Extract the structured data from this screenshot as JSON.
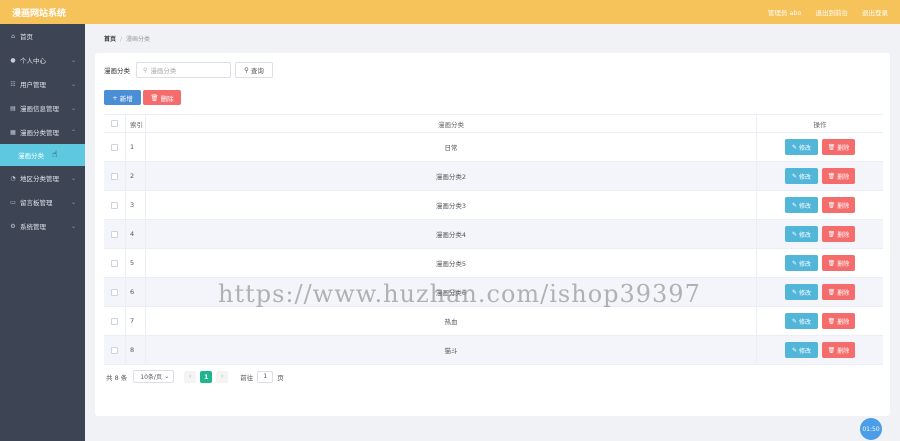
{
  "header": {
    "brand": "漫画网站系统",
    "links": [
      "管理员 abo",
      "退出到前台",
      "退出登录"
    ]
  },
  "sidebar": {
    "items": [
      {
        "icon": "home-icon",
        "glyph": "⌂",
        "label": "首页",
        "chevron": false
      },
      {
        "icon": "user-icon",
        "glyph": "●",
        "label": "个人中心",
        "chevron": true
      },
      {
        "icon": "users-icon",
        "glyph": "☷",
        "label": "用户管理",
        "chevron": true
      },
      {
        "icon": "book-icon",
        "glyph": "▤",
        "label": "漫画信息管理",
        "chevron": true
      },
      {
        "icon": "grid-icon",
        "glyph": "▦",
        "label": "漫画分类管理",
        "chevron": true
      },
      {
        "icon": "clock-icon",
        "glyph": "◔",
        "label": "地区分类管理",
        "chevron": true
      },
      {
        "icon": "message-icon",
        "glyph": "▭",
        "label": "留言板管理",
        "chevron": true
      },
      {
        "icon": "settings-icon",
        "glyph": "⚙",
        "label": "系统管理",
        "chevron": true
      }
    ],
    "active_sub": "漫画分类"
  },
  "breadcrumb": {
    "home": "首页",
    "current": "漫画分类"
  },
  "search": {
    "label": "漫画分类",
    "placeholder": "漫画分类",
    "button": "查询"
  },
  "actions": {
    "add": "新增",
    "delete": "删除"
  },
  "table": {
    "headers": {
      "index": "索引",
      "name": "漫画分类",
      "ops": "操作"
    },
    "rows": [
      {
        "index": "1",
        "name": "日常"
      },
      {
        "index": "2",
        "name": "漫画分类2"
      },
      {
        "index": "3",
        "name": "漫画分类3"
      },
      {
        "index": "4",
        "name": "漫画分类4"
      },
      {
        "index": "5",
        "name": "漫画分类5"
      },
      {
        "index": "6",
        "name": "漫画分类6"
      },
      {
        "index": "7",
        "name": "热血"
      },
      {
        "index": "8",
        "name": "猫斗"
      }
    ],
    "edit_label": "修改",
    "delete_label": "删除"
  },
  "pagination": {
    "total": "共 8 条",
    "page_size": "10条/页",
    "current_page": "1",
    "jump_prefix": "前往",
    "jump_value": "1",
    "jump_suffix": "页"
  },
  "watermark": "https://www.huzhan.com/ishop39397",
  "timer": "01:50"
}
